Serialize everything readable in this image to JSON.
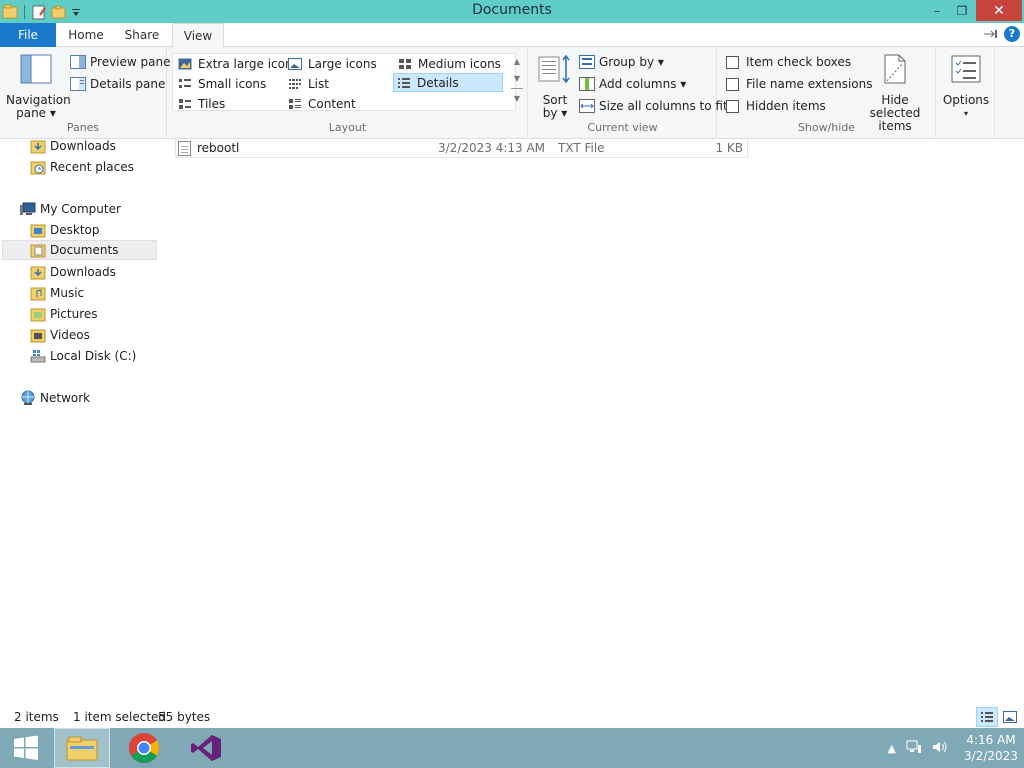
{
  "window": {
    "title": "Documents"
  },
  "window_controls": {
    "minimize": "–",
    "maximize": "❐",
    "close": "✕"
  },
  "tabs": {
    "file": "File",
    "home": "Home",
    "share": "Share",
    "view": "View",
    "help": "?"
  },
  "ribbon": {
    "panes": {
      "label": "Panes",
      "navigation_pane_line1": "Navigation",
      "navigation_pane_line2": "pane ▾",
      "preview_pane": "Preview pane",
      "details_pane": "Details pane"
    },
    "layout": {
      "label": "Layout",
      "items": [
        "Extra large icons",
        "Large icons",
        "Medium icons",
        "Small icons",
        "List",
        "Details",
        "Tiles",
        "Content"
      ],
      "selected": "Details"
    },
    "current_view": {
      "label": "Current view",
      "sort_by_line1": "Sort",
      "sort_by_line2": "by ▾",
      "group_by": "Group by ▾",
      "add_columns": "Add columns ▾",
      "size_all_columns": "Size all columns to fit"
    },
    "show_hide": {
      "label": "Show/hide",
      "item_check_boxes": "Item check boxes",
      "file_name_extensions": "File name extensions",
      "hidden_items": "Hidden items",
      "hide_selected_line1": "Hide selected",
      "hide_selected_line2": "items",
      "item_check_boxes_checked": false,
      "file_name_extensions_checked": false,
      "hidden_items_checked": false
    },
    "options": {
      "line1": "Options",
      "line2": "▾"
    }
  },
  "nav": {
    "downloads_fav": "Downloads",
    "recent_places": "Recent places",
    "my_computer": "My Computer",
    "desktop": "Desktop",
    "documents": "Documents",
    "downloads": "Downloads",
    "music": "Music",
    "pictures": "Pictures",
    "videos": "Videos",
    "local_disk": "Local Disk (C:)",
    "network": "Network",
    "selected": "Documents"
  },
  "files": [
    {
      "name": "rebootl",
      "date": "3/2/2023 4:13 AM",
      "type": "TXT File",
      "size": "1 KB"
    }
  ],
  "status": {
    "items": "2 items",
    "selected": "1 item selected",
    "size": "55 bytes"
  },
  "taskbar": {
    "time": "4:16 AM",
    "date": "3/2/2023"
  },
  "colors": {
    "title_bar": "#5fccc6",
    "file_tab": "#1979ca",
    "close_button": "#c7443c",
    "taskbar": "#7fa9b7",
    "selection": "#cce8ff"
  }
}
